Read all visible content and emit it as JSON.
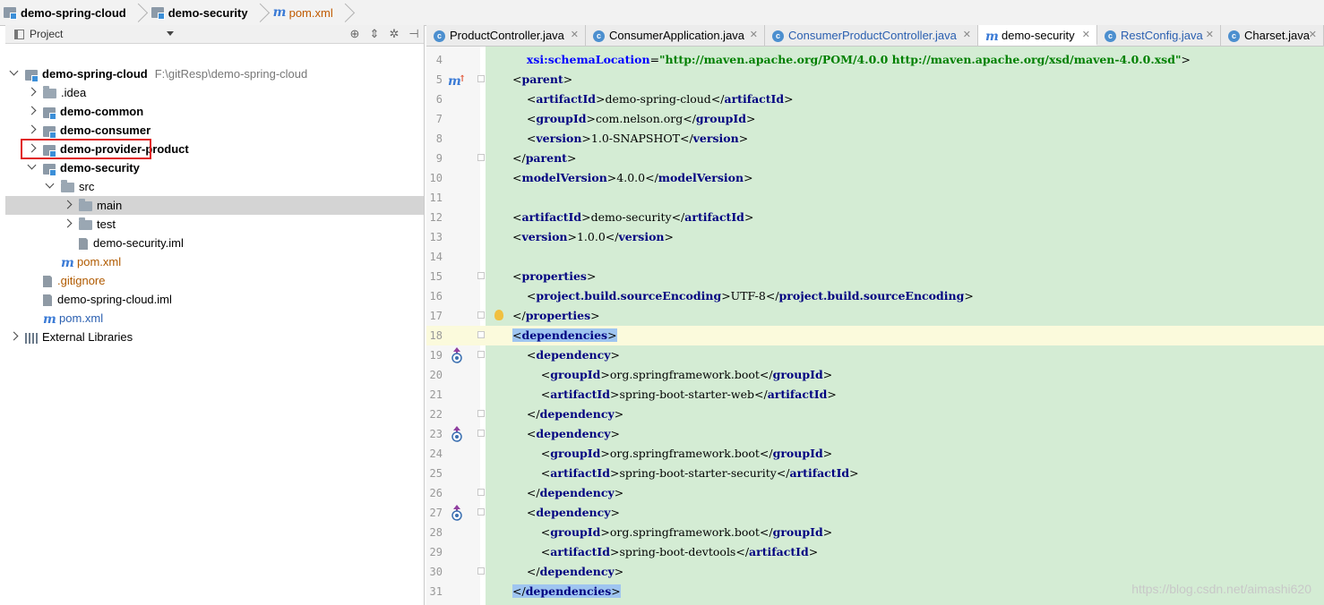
{
  "breadcrumbs": [
    {
      "label": "demo-spring-cloud",
      "type": "module"
    },
    {
      "label": "demo-security",
      "type": "module"
    },
    {
      "label": "pom.xml",
      "type": "maven-file"
    }
  ],
  "project_panel": {
    "title": "Project",
    "tree": [
      {
        "label": "demo-spring-cloud",
        "path": "F:\\gitResp\\demo-spring-cloud",
        "bold": true,
        "indent": 0,
        "expanded": true,
        "icon": "module-icon"
      },
      {
        "label": ".idea",
        "bold": false,
        "indent": 1,
        "expanded": false,
        "icon": "folder-icon"
      },
      {
        "label": "demo-common",
        "bold": true,
        "indent": 1,
        "expanded": false,
        "icon": "module-icon"
      },
      {
        "label": "demo-consumer",
        "bold": true,
        "indent": 1,
        "expanded": false,
        "icon": "module-icon"
      },
      {
        "label": "demo-provider-product",
        "bold": true,
        "indent": 1,
        "expanded": false,
        "icon": "module-icon"
      },
      {
        "label": "demo-security",
        "bold": true,
        "indent": 1,
        "expanded": true,
        "icon": "module-icon",
        "highlighted": true
      },
      {
        "label": "src",
        "bold": false,
        "indent": 2,
        "expanded": true,
        "icon": "folder-icon"
      },
      {
        "label": "main",
        "bold": false,
        "indent": 3,
        "expanded": false,
        "icon": "folder-icon",
        "selected": true
      },
      {
        "label": "test",
        "bold": false,
        "indent": 3,
        "expanded": false,
        "icon": "folder-icon"
      },
      {
        "label": "demo-security.iml",
        "bold": false,
        "indent": 3,
        "icon": "iml-file-icon"
      },
      {
        "label": "pom.xml",
        "bold": false,
        "indent": 2,
        "icon": "maven-icon",
        "color": "orange"
      },
      {
        "label": ".gitignore",
        "bold": false,
        "indent": 1,
        "icon": "file-icon",
        "color": "orange"
      },
      {
        "label": "demo-spring-cloud.iml",
        "bold": false,
        "indent": 1,
        "icon": "iml-file-icon"
      },
      {
        "label": "pom.xml",
        "bold": false,
        "indent": 1,
        "icon": "maven-icon",
        "color": "blue"
      },
      {
        "label": "External Libraries",
        "bold": false,
        "indent": 0,
        "expanded": false,
        "icon": "libraries-icon"
      }
    ]
  },
  "editor_tabs": [
    {
      "label": "ProductController.java",
      "icon": "class-icon",
      "active": false
    },
    {
      "label": "ConsumerApplication.java",
      "icon": "class-icon",
      "active": false
    },
    {
      "label": "ConsumerProductController.java",
      "icon": "class-icon",
      "active": false,
      "blue": true
    },
    {
      "label": "demo-security",
      "icon": "maven-icon",
      "active": true
    },
    {
      "label": "RestConfig.java",
      "icon": "class-icon",
      "active": false,
      "blue": true
    },
    {
      "label": "Charset.java",
      "icon": "class-icon",
      "active": false
    }
  ],
  "editor": {
    "current_line": 18,
    "lines": [
      {
        "n": 4,
        "code": "    xsi:schemaLocation=\"http://maven.apache.org/POM/4.0.0 http://maven.apache.org/xsd/maven-4.0.0.xsd\">"
      },
      {
        "n": 5,
        "code": "<parent>"
      },
      {
        "n": 6,
        "code": "    <artifactId>demo-spring-cloud</artifactId>"
      },
      {
        "n": 7,
        "code": "    <groupId>com.nelson.org</groupId>"
      },
      {
        "n": 8,
        "code": "    <version>1.0-SNAPSHOT</version>"
      },
      {
        "n": 9,
        "code": "</parent>"
      },
      {
        "n": 10,
        "code": "<modelVersion>4.0.0</modelVersion>"
      },
      {
        "n": 11,
        "code": ""
      },
      {
        "n": 12,
        "code": "<artifactId>demo-security</artifactId>"
      },
      {
        "n": 13,
        "code": "<version>1.0.0</version>"
      },
      {
        "n": 14,
        "code": ""
      },
      {
        "n": 15,
        "code": "<properties>"
      },
      {
        "n": 16,
        "code": "    <project.build.sourceEncoding>UTF-8</project.build.sourceEncoding>"
      },
      {
        "n": 17,
        "code": "</properties>"
      },
      {
        "n": 18,
        "code": "<dependencies>"
      },
      {
        "n": 19,
        "code": "    <dependency>"
      },
      {
        "n": 20,
        "code": "        <groupId>org.springframework.boot</groupId>"
      },
      {
        "n": 21,
        "code": "        <artifactId>spring-boot-starter-web</artifactId>"
      },
      {
        "n": 22,
        "code": "    </dependency>"
      },
      {
        "n": 23,
        "code": "    <dependency>"
      },
      {
        "n": 24,
        "code": "        <groupId>org.springframework.boot</groupId>"
      },
      {
        "n": 25,
        "code": "        <artifactId>spring-boot-starter-security</artifactId>"
      },
      {
        "n": 26,
        "code": "    </dependency>"
      },
      {
        "n": 27,
        "code": "    <dependency>"
      },
      {
        "n": 28,
        "code": "        <groupId>org.springframework.boot</groupId>"
      },
      {
        "n": 29,
        "code": "        <artifactId>spring-boot-devtools</artifactId>"
      },
      {
        "n": 30,
        "code": "    </dependency>"
      },
      {
        "n": 31,
        "code": "</dependencies>"
      }
    ]
  },
  "watermark": "https://blog.csdn.net/aimashi620",
  "colors": {
    "code_background": "#d4ecd4",
    "current_line": "#fbfadc",
    "tag": "#000080",
    "string": "#008000",
    "highlight_box": "#e02020"
  }
}
